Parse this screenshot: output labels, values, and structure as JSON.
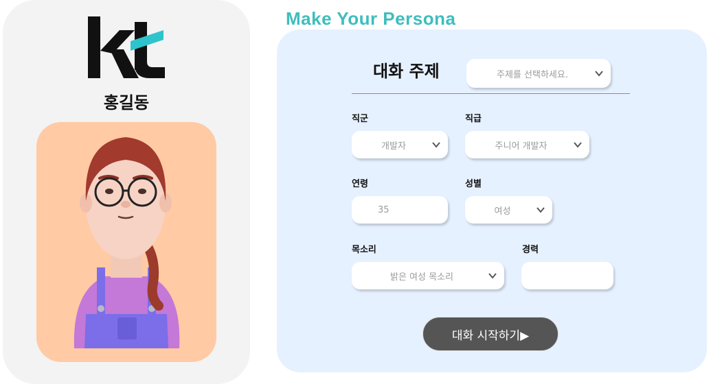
{
  "profile": {
    "logo_text": "kt",
    "name": "홍길동"
  },
  "page": {
    "title": "Make Your Persona"
  },
  "form": {
    "topic": {
      "label": "대화 주제",
      "placeholder": "주제를 선택하세요."
    },
    "position": {
      "label": "직군",
      "value": "개발자"
    },
    "rank": {
      "label": "직급",
      "value": "주니어 개발자"
    },
    "age": {
      "label": "연령",
      "value": "35"
    },
    "gender": {
      "label": "성별",
      "value": "여성"
    },
    "voice": {
      "label": "목소리",
      "value": "밝은 여성 목소리"
    },
    "career": {
      "label": "경력",
      "value": ""
    },
    "start_button": "대화 시작하기▶"
  },
  "colors": {
    "accent_teal": "#3fbdbd",
    "panel_blue": "#e6f1ff",
    "avatar_bg": "#ffcaa4",
    "button_dark": "#555555"
  }
}
